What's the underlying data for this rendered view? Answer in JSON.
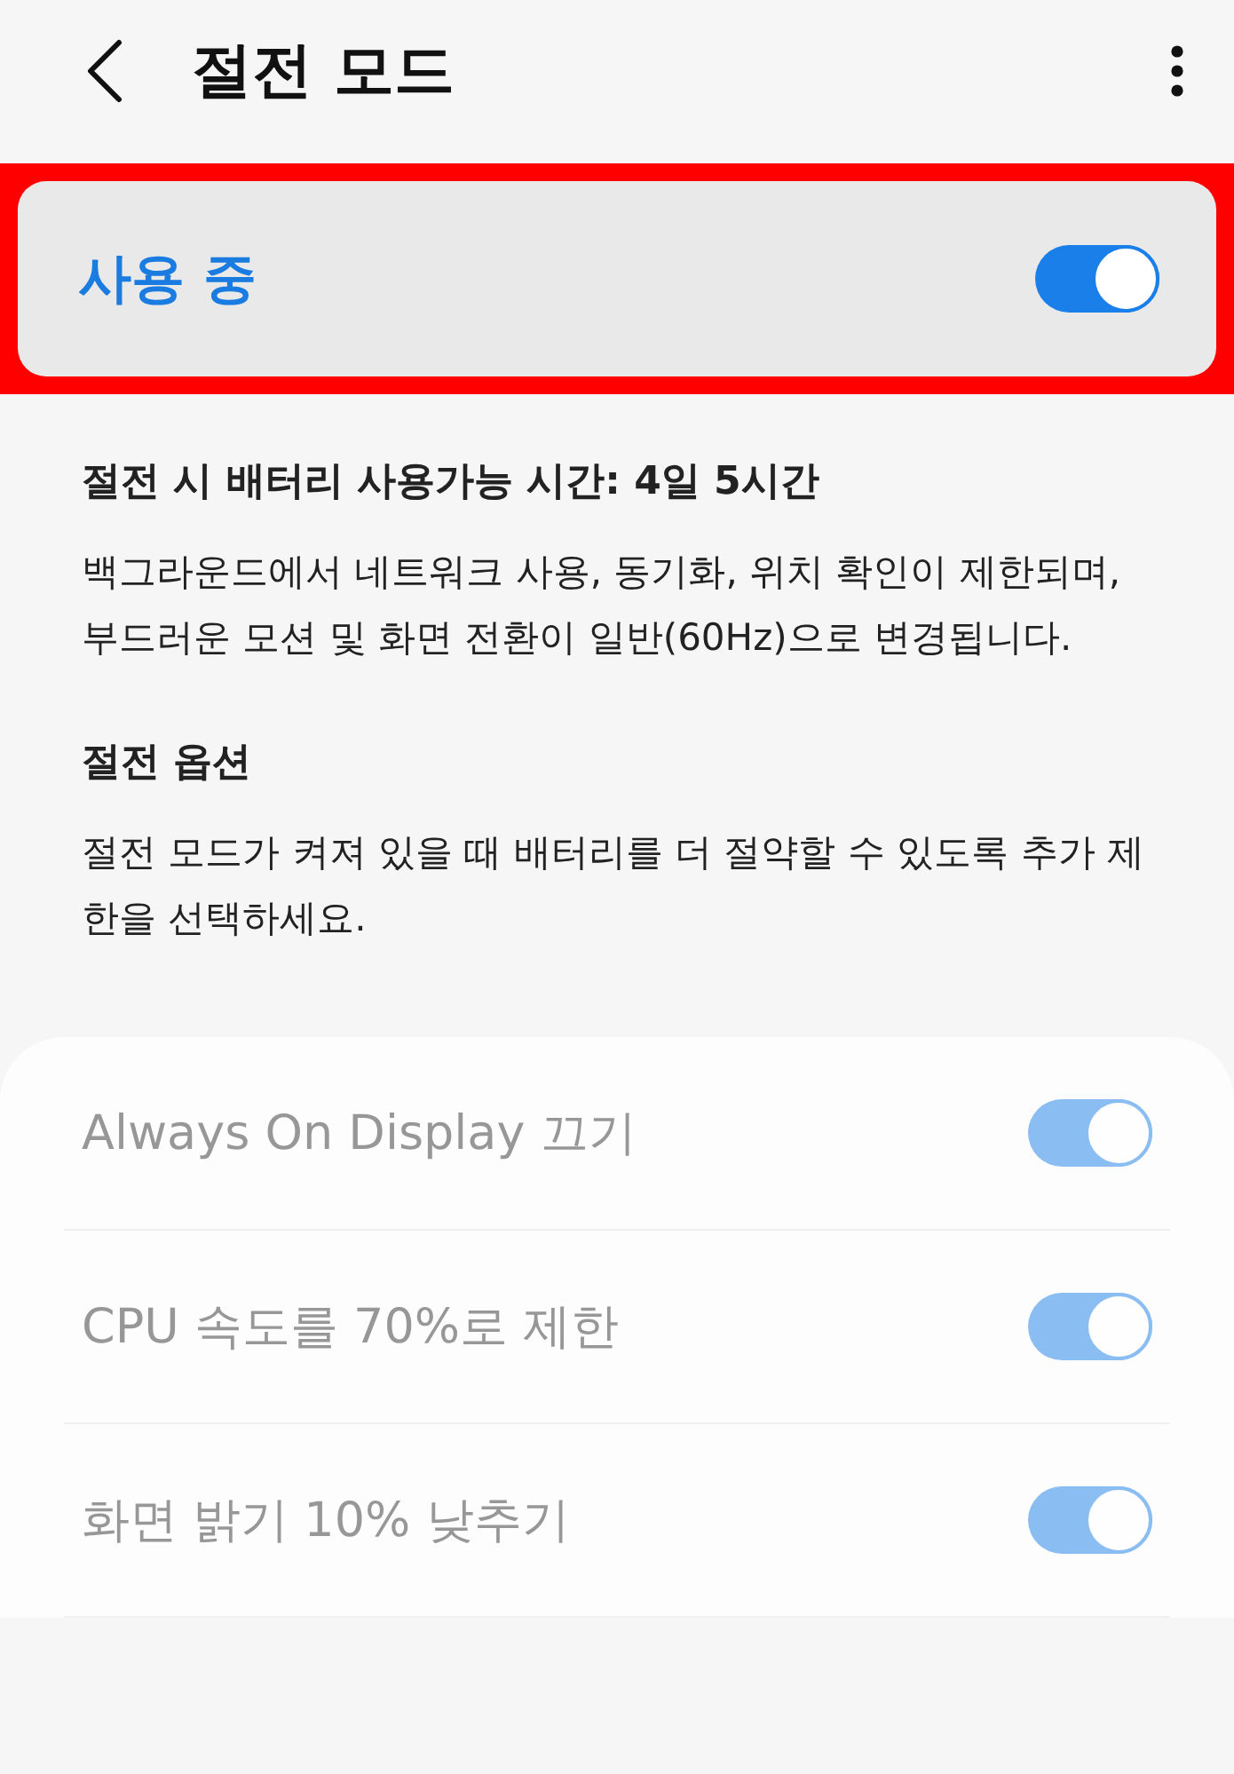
{
  "header": {
    "title": "절전 모드"
  },
  "master": {
    "label": "사용 중",
    "on": true,
    "highlighted": true
  },
  "battery_estimate": "절전 시 배터리 사용가능 시간: 4일 5시간",
  "description": "백그라운드에서 네트워크 사용, 동기화, 위치 확인이 제한되며, 부드러운 모션 및 화면 전환이 일반(60Hz)으로 변경됩니다.",
  "options_heading": "절전 옵션",
  "options_description": "절전 모드가 켜져 있을 때 배터리를 더 절약할 수 있도록 추가 제한을 선택하세요.",
  "options": [
    {
      "label": "Always On Display 끄기",
      "on": true,
      "disabled": true
    },
    {
      "label": "CPU 속도를 70%로 제한",
      "on": true,
      "disabled": true
    },
    {
      "label": "화면 밝기 10% 낮추기",
      "on": true,
      "disabled": true
    }
  ]
}
